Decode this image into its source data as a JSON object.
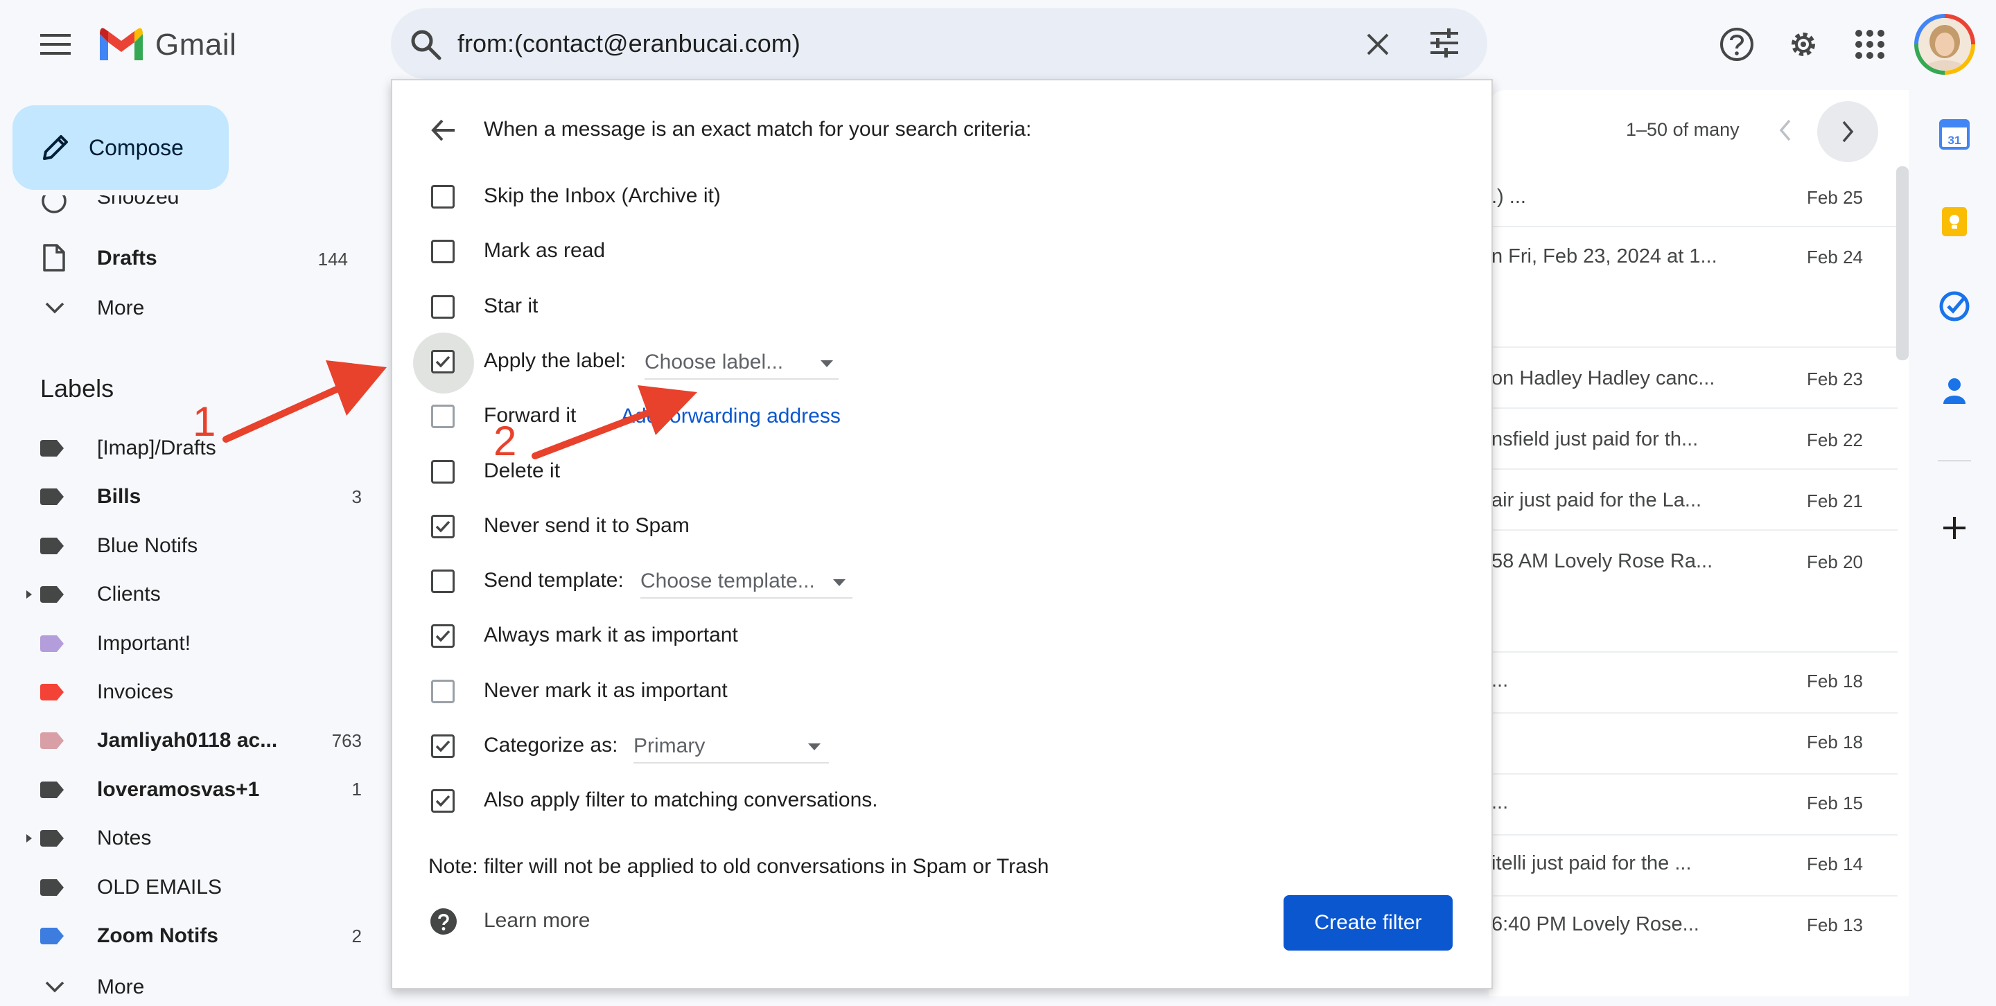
{
  "app": {
    "name": "Gmail",
    "brand_colors": {
      "red": "#ea4335",
      "blue": "#4285f4",
      "green": "#34a853",
      "yellow": "#fbbc04"
    }
  },
  "search": {
    "query": "from:(contact@eranbucai.com)"
  },
  "nav": {
    "compose_label": "Compose",
    "items": [
      {
        "label": "Snoozed",
        "count": "",
        "icon": "clock-icon"
      },
      {
        "label": "Drafts",
        "count": "144",
        "icon": "draft-icon"
      },
      {
        "label": "More",
        "count": "",
        "icon": "chevron-down-icon"
      }
    ],
    "labels_heading": "Labels",
    "labels": [
      {
        "name": "[Imap]/Drafts",
        "count": "",
        "color": "#444746",
        "bold": false
      },
      {
        "name": "Bills",
        "count": "3",
        "color": "#444746",
        "bold": true
      },
      {
        "name": "Blue Notifs",
        "count": "",
        "color": "#444746",
        "bold": false
      },
      {
        "name": "Clients",
        "count": "",
        "color": "#444746",
        "bold": false
      },
      {
        "name": "Important!",
        "count": "",
        "color": "#b39ddb",
        "bold": false
      },
      {
        "name": "Invoices",
        "count": "",
        "color": "#f44336",
        "bold": false
      },
      {
        "name": "Jamliyah0118 ac...",
        "count": "763",
        "color": "#d8a0a6",
        "bold": true
      },
      {
        "name": "loveramosvas+1",
        "count": "1",
        "color": "#444746",
        "bold": true
      },
      {
        "name": "Notes",
        "count": "",
        "color": "#444746",
        "bold": false
      },
      {
        "name": "OLD EMAILS",
        "count": "",
        "color": "#444746",
        "bold": false
      },
      {
        "name": "Zoom Notifs",
        "count": "2",
        "color": "#3d7de0",
        "bold": true
      }
    ],
    "more_bottom": "More"
  },
  "mail": {
    "pagination": "1–50 of many",
    "rows": [
      {
        "snippet": ".)                    ...",
        "date": "Feb 25"
      },
      {
        "snippet": "n Fri, Feb 23, 2024 at 1...",
        "date": "Feb 24"
      },
      {
        "snippet": "on Hadley Hadley canc...",
        "date": "Feb 23"
      },
      {
        "snippet": "nsfield just paid for th...",
        "date": "Feb 22"
      },
      {
        "snippet": "air just paid for the La...",
        "date": "Feb 21"
      },
      {
        "snippet": "58 AM Lovely Rose Ra...",
        "date": "Feb 20"
      },
      {
        "snippet": "                            ...",
        "date": "Feb 18"
      },
      {
        "snippet": "",
        "date": "Feb 18"
      },
      {
        "snippet": "                              ...",
        "date": "Feb 15"
      },
      {
        "snippet": "itelli just paid for the ...",
        "date": "Feb 14"
      },
      {
        "snippet": " 6:40 PM Lovely Rose...",
        "date": "Feb 13"
      }
    ]
  },
  "filter": {
    "header": "When a message is an exact match for your search criteria:",
    "options": [
      {
        "label": "Skip the Inbox (Archive it)",
        "checked": false
      },
      {
        "label": "Mark as read",
        "checked": false
      },
      {
        "label": "Star it",
        "checked": false
      },
      {
        "label": "Apply the label:",
        "checked": true
      },
      {
        "label": "Forward it",
        "checked": false
      },
      {
        "label": "Delete it",
        "checked": false
      },
      {
        "label": "Never send it to Spam",
        "checked": true
      },
      {
        "label": "Send template:",
        "checked": false
      },
      {
        "label": "Always mark it as important",
        "checked": true
      },
      {
        "label": "Never mark it as important",
        "checked": false
      },
      {
        "label": "Categorize as:",
        "checked": true
      },
      {
        "label": "Also apply filter to matching conversations.",
        "checked": true
      }
    ],
    "label_select": "Choose label...",
    "forward_link": "Add forwarding address",
    "template_select": "Choose template...",
    "category_select": "Primary",
    "note": "Note: filter will not be applied to old conversations in Spam or Trash",
    "learn_more": "Learn more",
    "create_button": "Create filter"
  },
  "annotations": {
    "arrow_color": "#e8412c",
    "num1": "1",
    "num2": "2"
  }
}
